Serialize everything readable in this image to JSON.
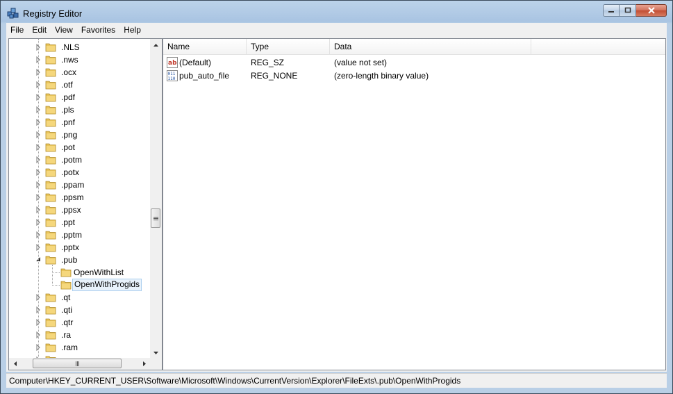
{
  "window": {
    "title": "Registry Editor",
    "minimize_label": "minimize",
    "maximize_label": "maximize",
    "close_label": "close"
  },
  "menu": [
    "File",
    "Edit",
    "View",
    "Favorites",
    "Help"
  ],
  "tree": {
    "items": [
      {
        "label": ".NLS",
        "expander": "collapsed",
        "level": 1
      },
      {
        "label": ".nws",
        "expander": "collapsed",
        "level": 1
      },
      {
        "label": ".ocx",
        "expander": "collapsed",
        "level": 1
      },
      {
        "label": ".otf",
        "expander": "collapsed",
        "level": 1
      },
      {
        "label": ".pdf",
        "expander": "collapsed",
        "level": 1
      },
      {
        "label": ".pls",
        "expander": "collapsed",
        "level": 1
      },
      {
        "label": ".pnf",
        "expander": "collapsed",
        "level": 1
      },
      {
        "label": ".png",
        "expander": "collapsed",
        "level": 1
      },
      {
        "label": ".pot",
        "expander": "collapsed",
        "level": 1
      },
      {
        "label": ".potm",
        "expander": "collapsed",
        "level": 1
      },
      {
        "label": ".potx",
        "expander": "collapsed",
        "level": 1
      },
      {
        "label": ".ppam",
        "expander": "collapsed",
        "level": 1
      },
      {
        "label": ".ppsm",
        "expander": "collapsed",
        "level": 1
      },
      {
        "label": ".ppsx",
        "expander": "collapsed",
        "level": 1
      },
      {
        "label": ".ppt",
        "expander": "collapsed",
        "level": 1
      },
      {
        "label": ".pptm",
        "expander": "collapsed",
        "level": 1
      },
      {
        "label": ".pptx",
        "expander": "collapsed",
        "level": 1
      },
      {
        "label": ".pub",
        "expander": "expanded",
        "level": 1
      },
      {
        "label": "OpenWithList",
        "expander": "none",
        "level": 2
      },
      {
        "label": "OpenWithProgids",
        "expander": "none",
        "level": 2,
        "selected": true
      },
      {
        "label": ".qt",
        "expander": "collapsed",
        "level": 1
      },
      {
        "label": ".qti",
        "expander": "collapsed",
        "level": 1
      },
      {
        "label": ".qtr",
        "expander": "collapsed",
        "level": 1
      },
      {
        "label": ".ra",
        "expander": "collapsed",
        "level": 1
      },
      {
        "label": ".ram",
        "expander": "collapsed",
        "level": 1
      },
      {
        "label": ".rar",
        "expander": "collapsed",
        "level": 1
      }
    ]
  },
  "list": {
    "columns": [
      "Name",
      "Type",
      "Data"
    ],
    "rows": [
      {
        "icon": "string-value-icon",
        "name": "(Default)",
        "type": "REG_SZ",
        "data": "(value not set)"
      },
      {
        "icon": "binary-value-icon",
        "name": "pub_auto_file",
        "type": "REG_NONE",
        "data": "(zero-length binary value)"
      }
    ]
  },
  "status": {
    "path": "Computer\\HKEY_CURRENT_USER\\Software\\Microsoft\\Windows\\CurrentVersion\\Explorer\\FileExts\\.pub\\OpenWithProgids"
  },
  "colors": {
    "selection_bg": "#e8f2fb",
    "selection_border": "#a9cdee",
    "folder": "#e8c45a"
  }
}
